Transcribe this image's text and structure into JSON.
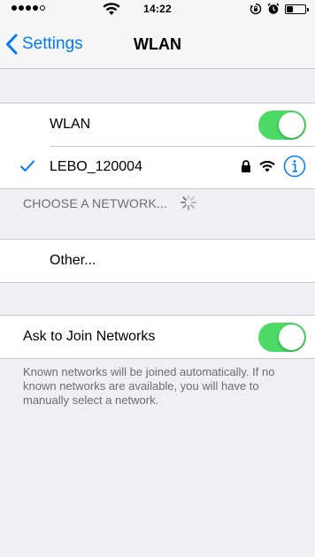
{
  "status_bar": {
    "time": "14:22",
    "signal_bars_filled": 4,
    "signal_bars_total": 5,
    "battery_level": 0.35
  },
  "nav": {
    "back_label": "Settings",
    "title": "WLAN"
  },
  "wlan_group": {
    "wlan_label": "WLAN",
    "wlan_on": true,
    "connected_network": "LEBO_120004"
  },
  "networks_section": {
    "header": "CHOOSE A NETWORK...",
    "other_label": "Other..."
  },
  "ask_group": {
    "label": "Ask to Join Networks",
    "on": true,
    "footnote": "Known networks will be joined automatically. If no known networks are available, you will have to manually select a network."
  },
  "colors": {
    "accent": "#007aff",
    "toggle_on": "#4cd964",
    "background": "#efeff4",
    "section_text": "#6d6d72"
  },
  "icons": {
    "back": "chevron-left-icon",
    "check": "checkmark-icon",
    "lock": "lock-icon",
    "wifi": "wifi-icon",
    "info": "info-icon",
    "spinner": "spinner-icon"
  }
}
